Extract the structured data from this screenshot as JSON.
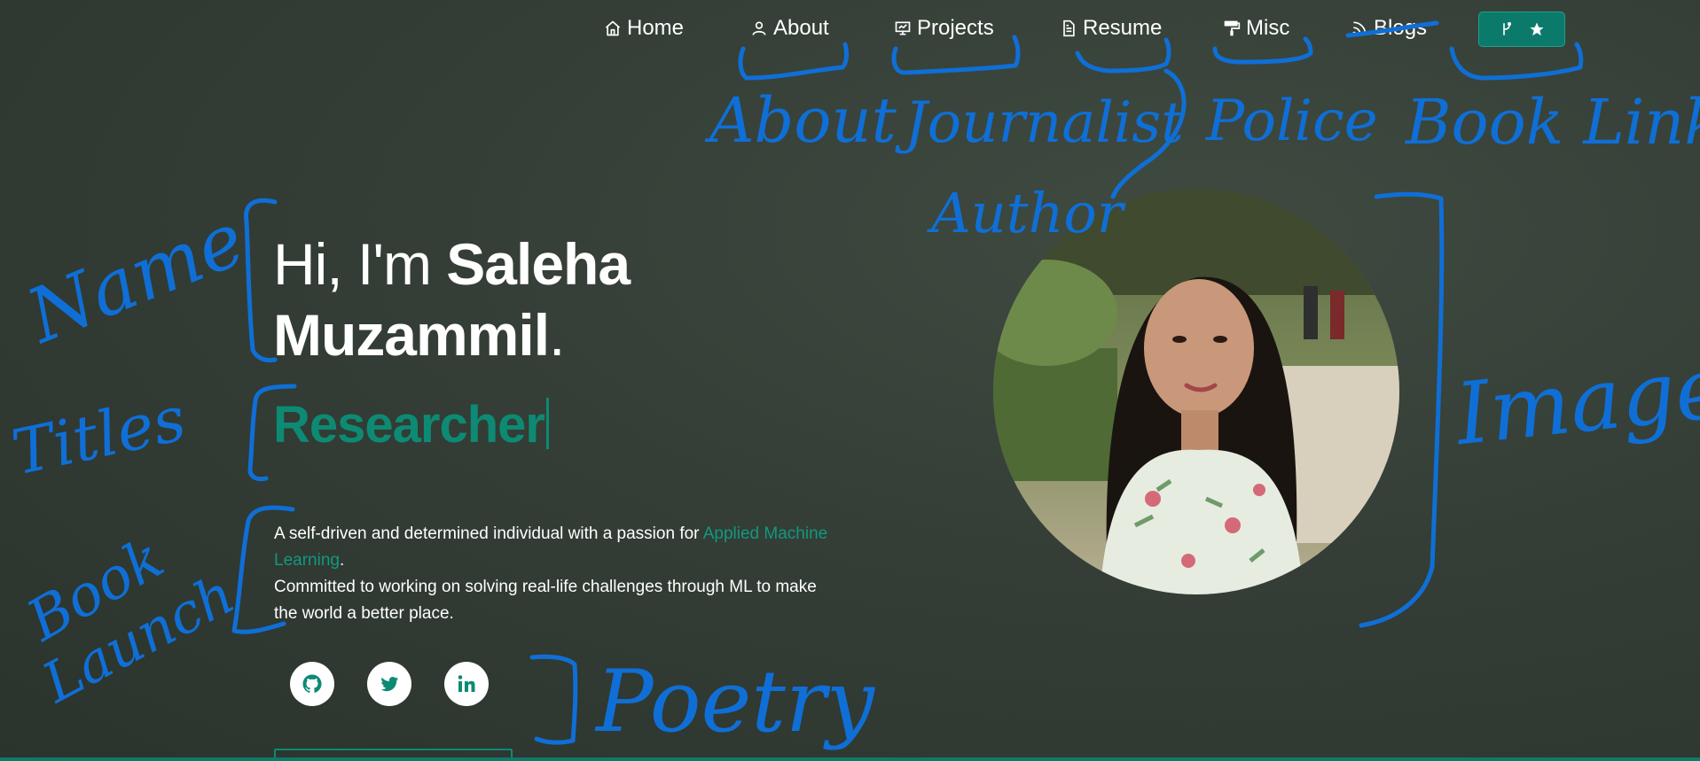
{
  "nav": {
    "home": "Home",
    "about": "About",
    "projects": "Projects",
    "resume": "Resume",
    "misc": "Misc",
    "blogs": "Blogs"
  },
  "hero": {
    "greeting": "Hi, I'm ",
    "first_name": "Saleha",
    "last_name": "Muzammil",
    "period": ".",
    "role": "Researcher"
  },
  "bio": {
    "line1_prefix": "A self-driven and determined individual with a passion for ",
    "line1_highlight": "Applied Machine Learning",
    "line1_suffix": ".",
    "line2": "Committed to working on solving real-life challenges through ML to make the world a better place."
  },
  "annotations": {
    "about": "About",
    "journalist": "Journalist",
    "police": "Police",
    "book_link": "Book Link",
    "author": "Author",
    "name": "Name",
    "titles": "Titles",
    "book_launch_1": "Book",
    "book_launch_2": "Launch",
    "image": "Image",
    "poetry": "Poetry"
  },
  "colors": {
    "accent": "#0d8a73",
    "background": "#343e36",
    "annotation": "#0f6fd6"
  },
  "icons": {
    "home": "home-icon",
    "about": "user-icon",
    "projects": "presentation-icon",
    "resume": "document-icon",
    "misc": "paint-roller-icon",
    "blogs": "rss-icon",
    "fork": "git-fork-icon",
    "star": "star-icon",
    "github": "github-icon",
    "twitter": "twitter-icon",
    "linkedin": "linkedin-icon"
  }
}
